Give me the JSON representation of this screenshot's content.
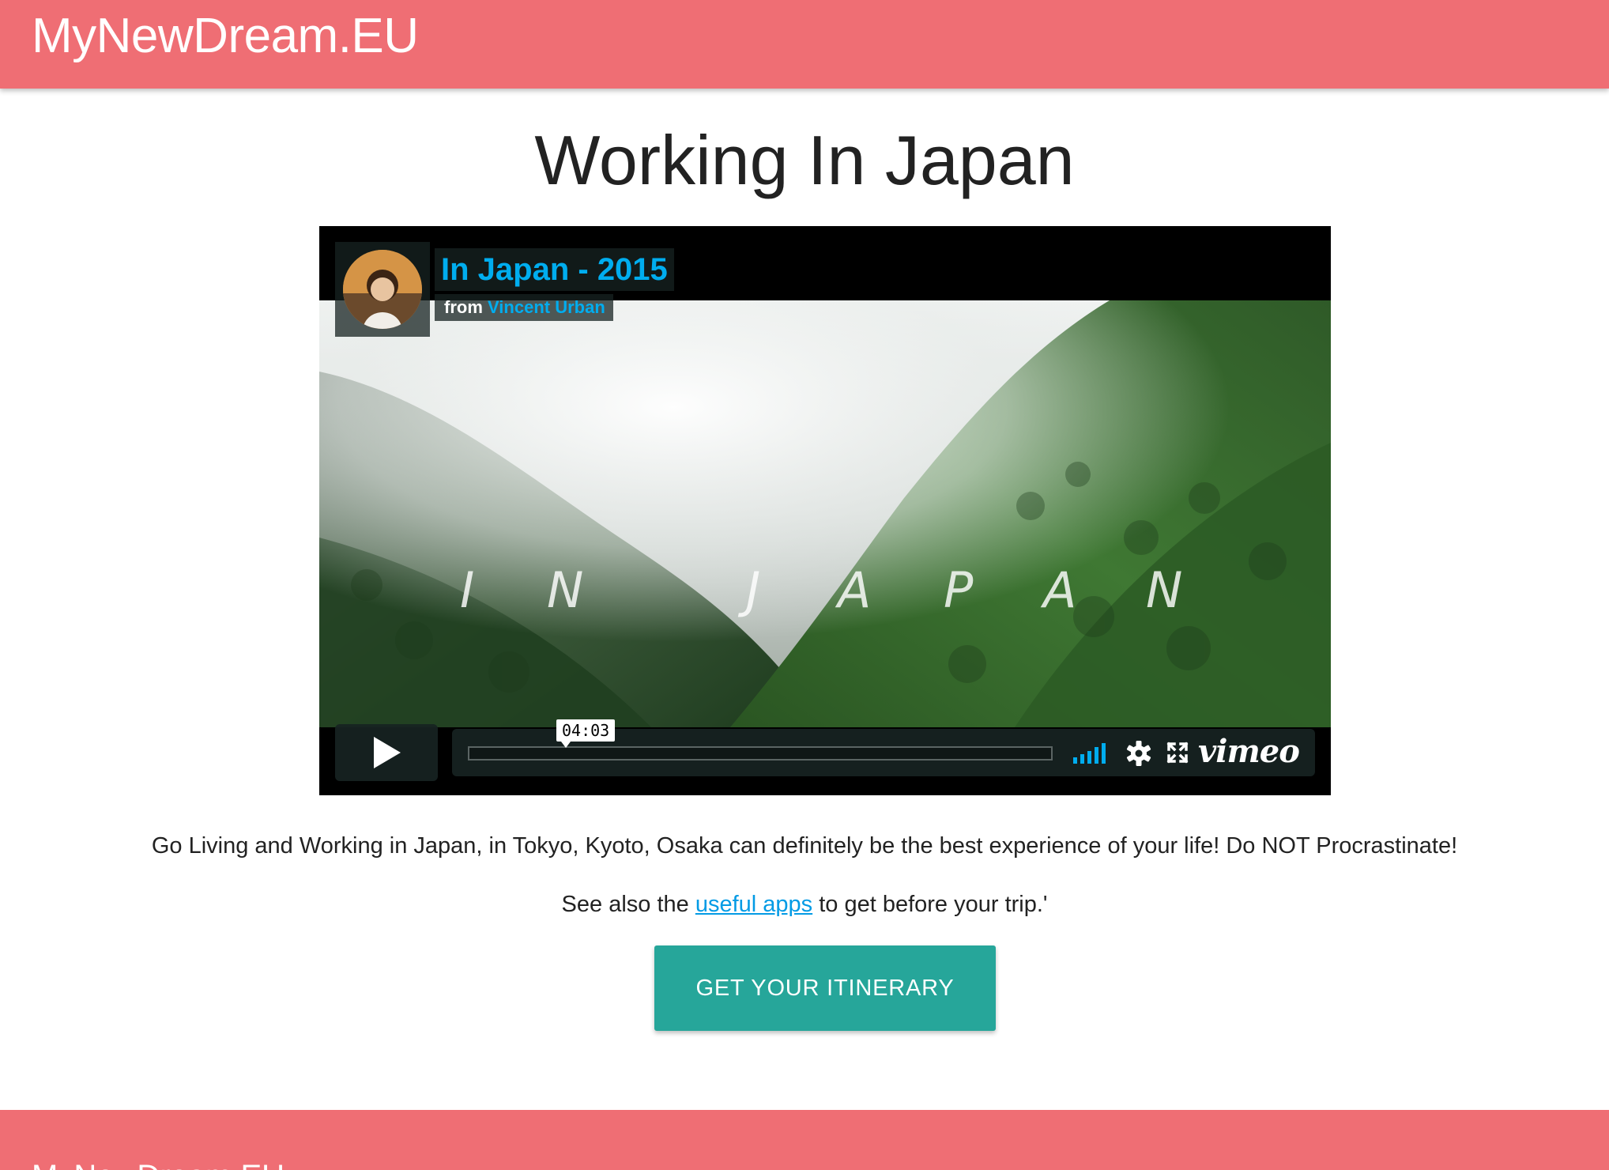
{
  "header": {
    "brand": "MyNewDream.EU"
  },
  "page": {
    "title": "Working In Japan"
  },
  "video": {
    "title": "In Japan - 2015",
    "from_label": "from",
    "author": "Vincent Urban",
    "overlay_letters": [
      "I",
      "N",
      "J",
      "A",
      "P",
      "A",
      "N"
    ],
    "time": "04:03",
    "provider": "vimeo",
    "colors": {
      "accent": "#00adef",
      "forest_dark": "#1e3a1f",
      "forest_light": "#3f7a34",
      "mist": "#e6e9e8"
    }
  },
  "content": {
    "description": "Go Living and Working in Japan, in Tokyo, Kyoto, Osaka can definitely be the best experience of your life! Do NOT Procrastinate!",
    "see_also_prefix": "See also the ",
    "see_also_link": "useful apps",
    "see_also_suffix": " to get before your trip.'"
  },
  "cta": {
    "label": "GET YOUR ITINERARY"
  },
  "footer": {
    "brand": "MyNewDream.EU"
  },
  "colors": {
    "brand": "#ef6e74",
    "button": "#26a69a",
    "link": "#039be5"
  }
}
